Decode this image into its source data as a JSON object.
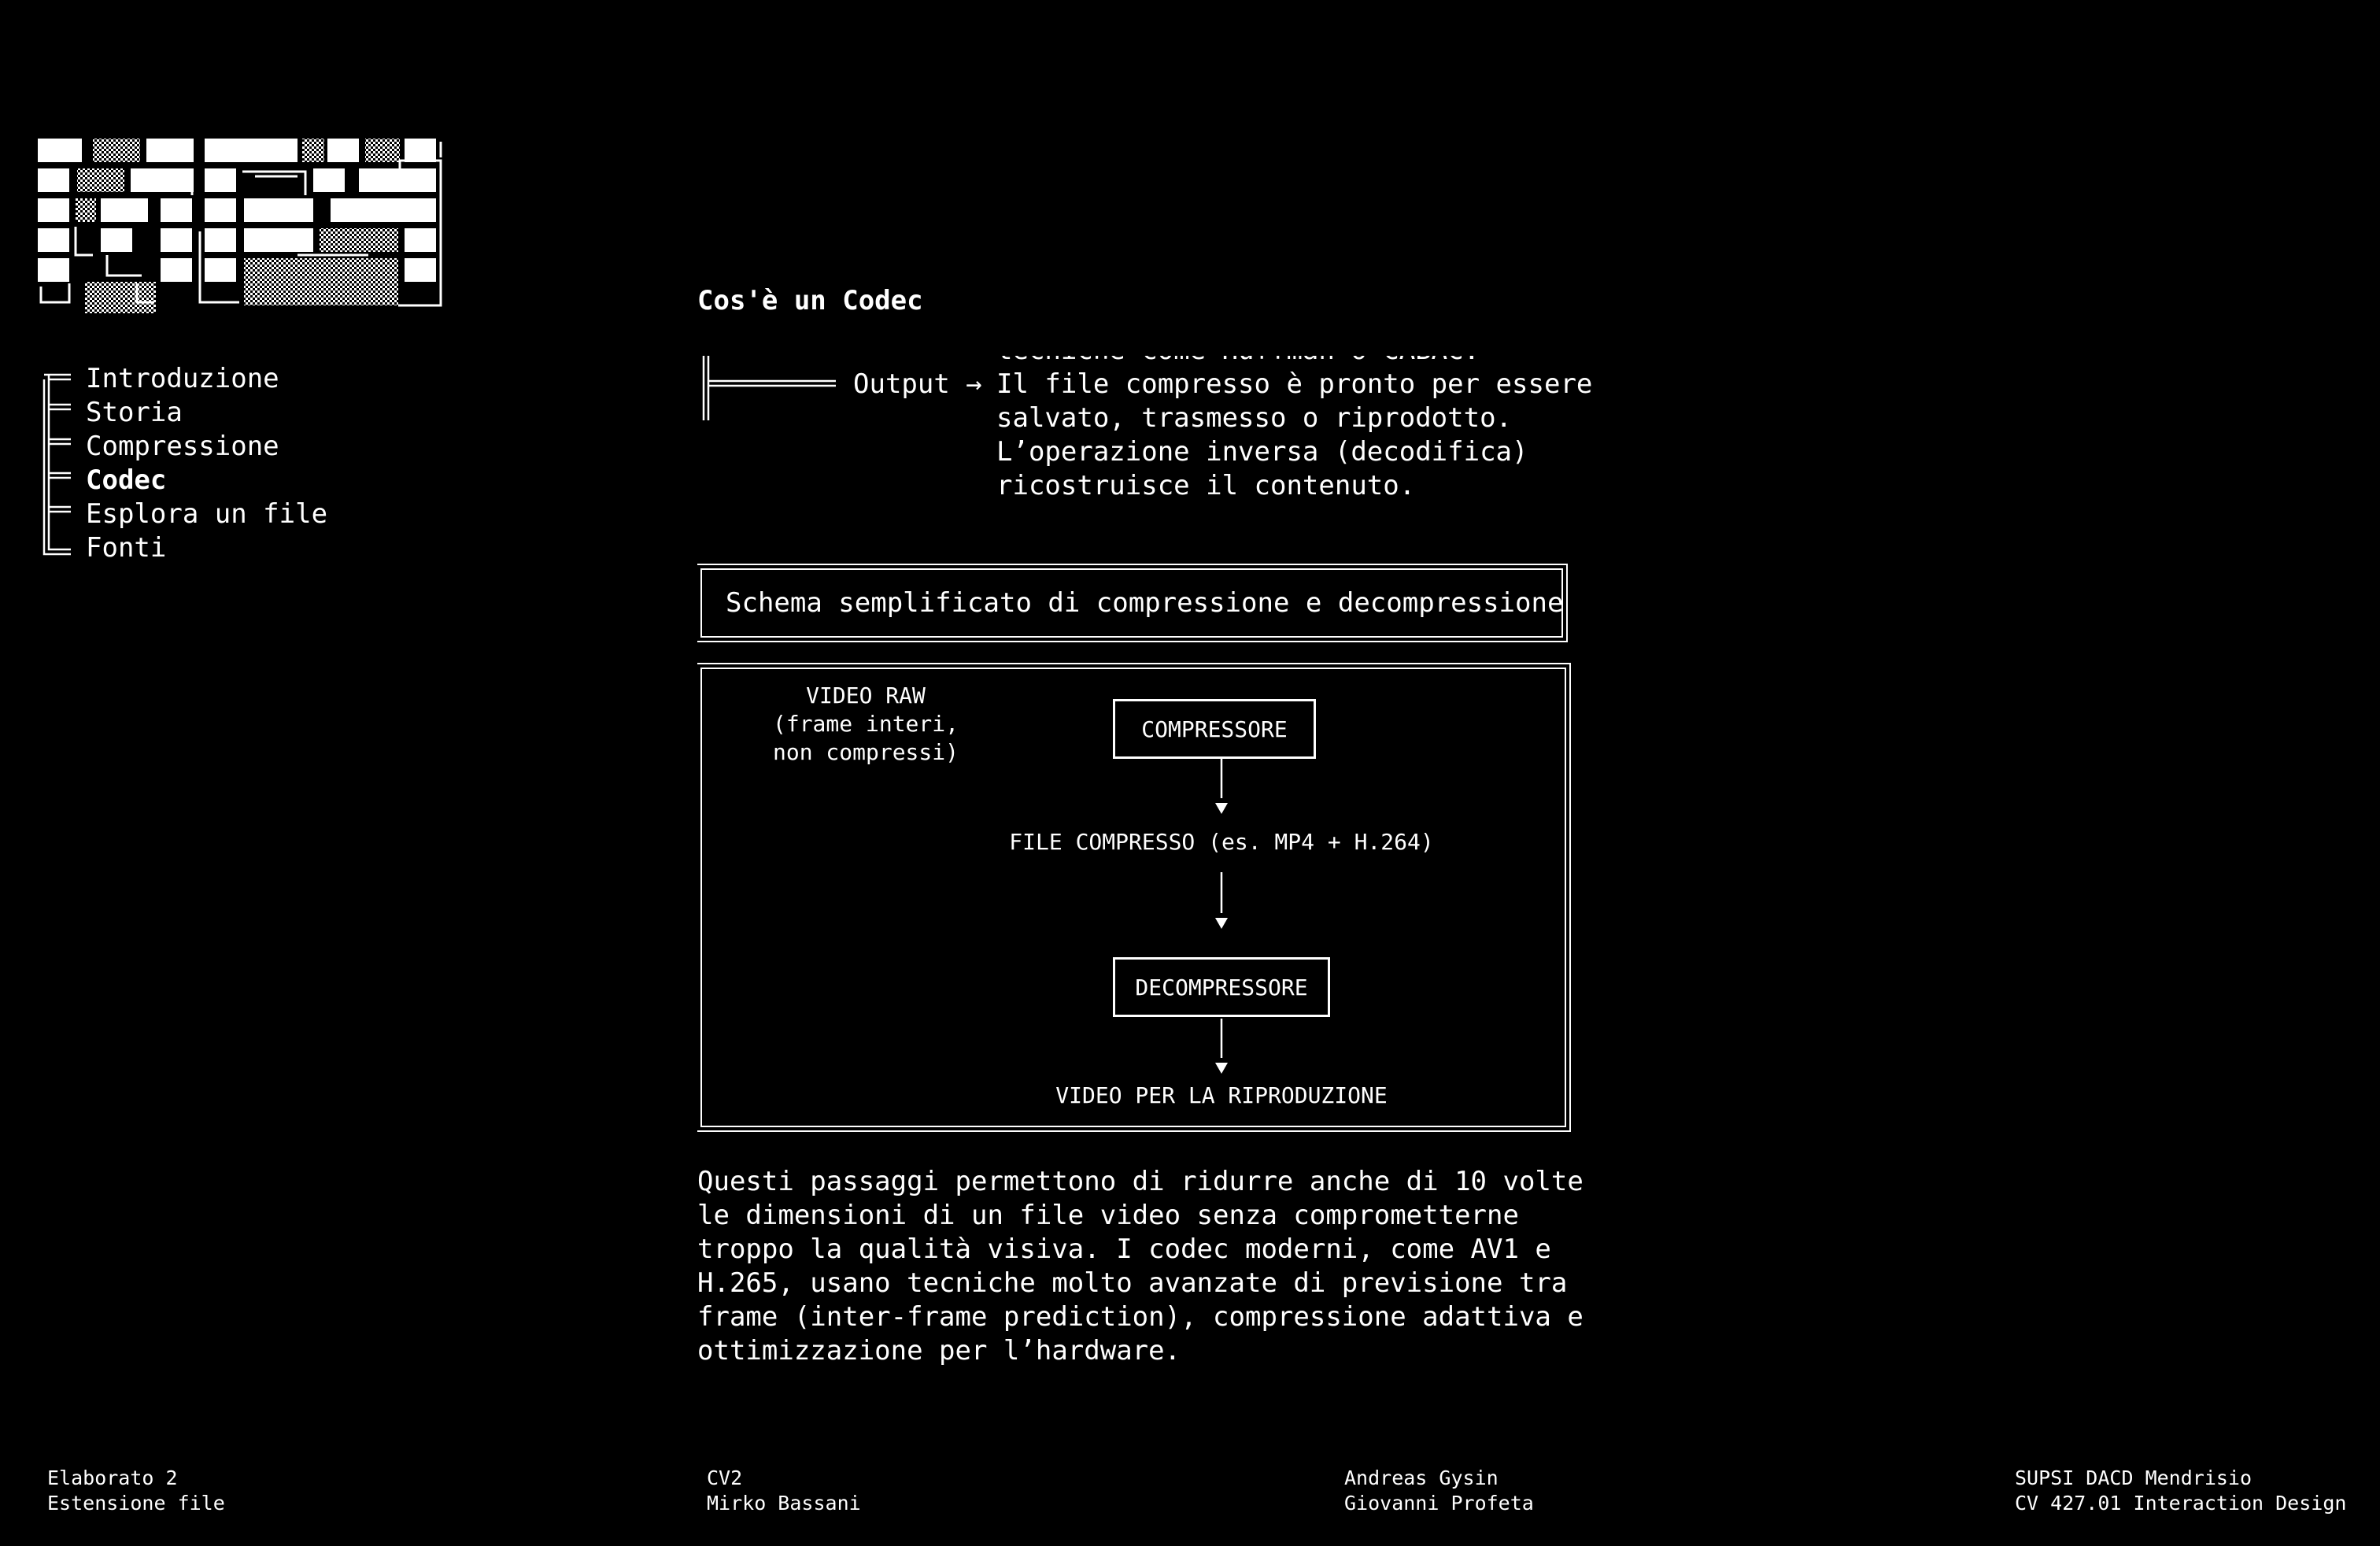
{
  "logo": {
    "alt": "logo"
  },
  "nav": {
    "items": [
      {
        "label": "Introduzione",
        "active": false
      },
      {
        "label": "Storia",
        "active": false
      },
      {
        "label": "Compressione",
        "active": false
      },
      {
        "label": "Codec",
        "active": true
      },
      {
        "label": "Esplora un file",
        "active": false
      },
      {
        "label": "Fonti",
        "active": false
      }
    ]
  },
  "main": {
    "section_title": "Cos'è un Codec",
    "step": {
      "label": "Output →",
      "text_lines": [
        "tecniche come Huffman o CABAC.",
        "Il file compresso è pronto per essere",
        "salvato, trasmesso o riprodotto.",
        "L’operazione inversa (decodifica)",
        "ricostruisce il contenuto."
      ]
    },
    "caption": "Schema semplificato di compressione e decompressione",
    "diagram": {
      "raw_label": "VIDEO RAW\n(frame interi,\nnon compressi)",
      "compressor": "COMPRESSORE",
      "compressed_file": "FILE COMPRESSO (es. MP4 + H.264)",
      "decompressor": "DECOMPRESSORE",
      "output": "VIDEO PER LA RIPRODUZIONE",
      "arrow_glyph": "▼"
    },
    "paragraph_lines": [
      "Questi passaggi permettono di ridurre anche di 10 volte",
      "le dimensioni di un file video senza comprometterne",
      "troppo la qualità visiva. I codec moderni, come AV1 e",
      "H.265, usano tecniche molto avanzate di previsione tra",
      "frame (inter-frame prediction), compressione adattiva e",
      "ottimizzazione per l’hardware."
    ]
  },
  "footer": {
    "col1": "Elaborato 2\nEstensione file",
    "col2": "CV2\nMirko Bassani",
    "col3": "Andreas Gysin\nGiovanni Profeta",
    "col4": "SUPSI DACD Mendrisio\nCV 427.01 Interaction Design"
  }
}
